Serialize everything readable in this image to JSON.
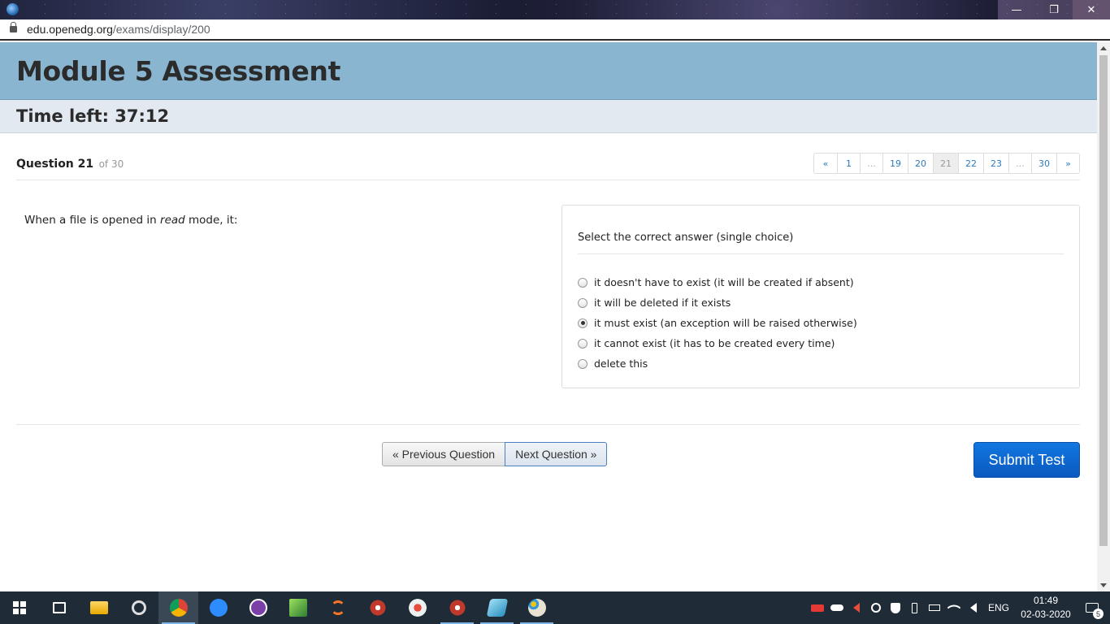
{
  "browser": {
    "url_domain": "edu.openedg.org",
    "url_path": "/exams/display/200",
    "window_buttons": [
      "—",
      "❐",
      "✕"
    ]
  },
  "exam": {
    "title": "Module 5 Assessment",
    "timer": "Time left: 37:12"
  },
  "question": {
    "label": "Question 21",
    "of": "of 30",
    "text_before": "When a file is opened in ",
    "text_em": "read",
    "text_after": " mode, it:"
  },
  "pager": [
    "«",
    "1",
    "...",
    "19",
    "20",
    "21",
    "22",
    "23",
    "...",
    "30",
    "»"
  ],
  "pager_active": "21",
  "answers": {
    "prompt": "Select the correct answer (single choice)",
    "options": [
      {
        "label": "it doesn't have to exist (it will be created if absent)",
        "checked": false
      },
      {
        "label": "it will be deleted if it exists",
        "checked": false
      },
      {
        "label": "it must exist (an exception will be raised otherwise)",
        "checked": true
      },
      {
        "label": "it cannot exist (it has to be created every time)",
        "checked": false
      },
      {
        "label": "delete this",
        "checked": false
      }
    ]
  },
  "nav": {
    "prev": "« Previous Question",
    "next": "Next Question »",
    "submit": "Submit Test"
  },
  "taskbar": {
    "lang": "ENG",
    "time": "01:49",
    "date": "02-03-2020",
    "notifications": "5"
  }
}
